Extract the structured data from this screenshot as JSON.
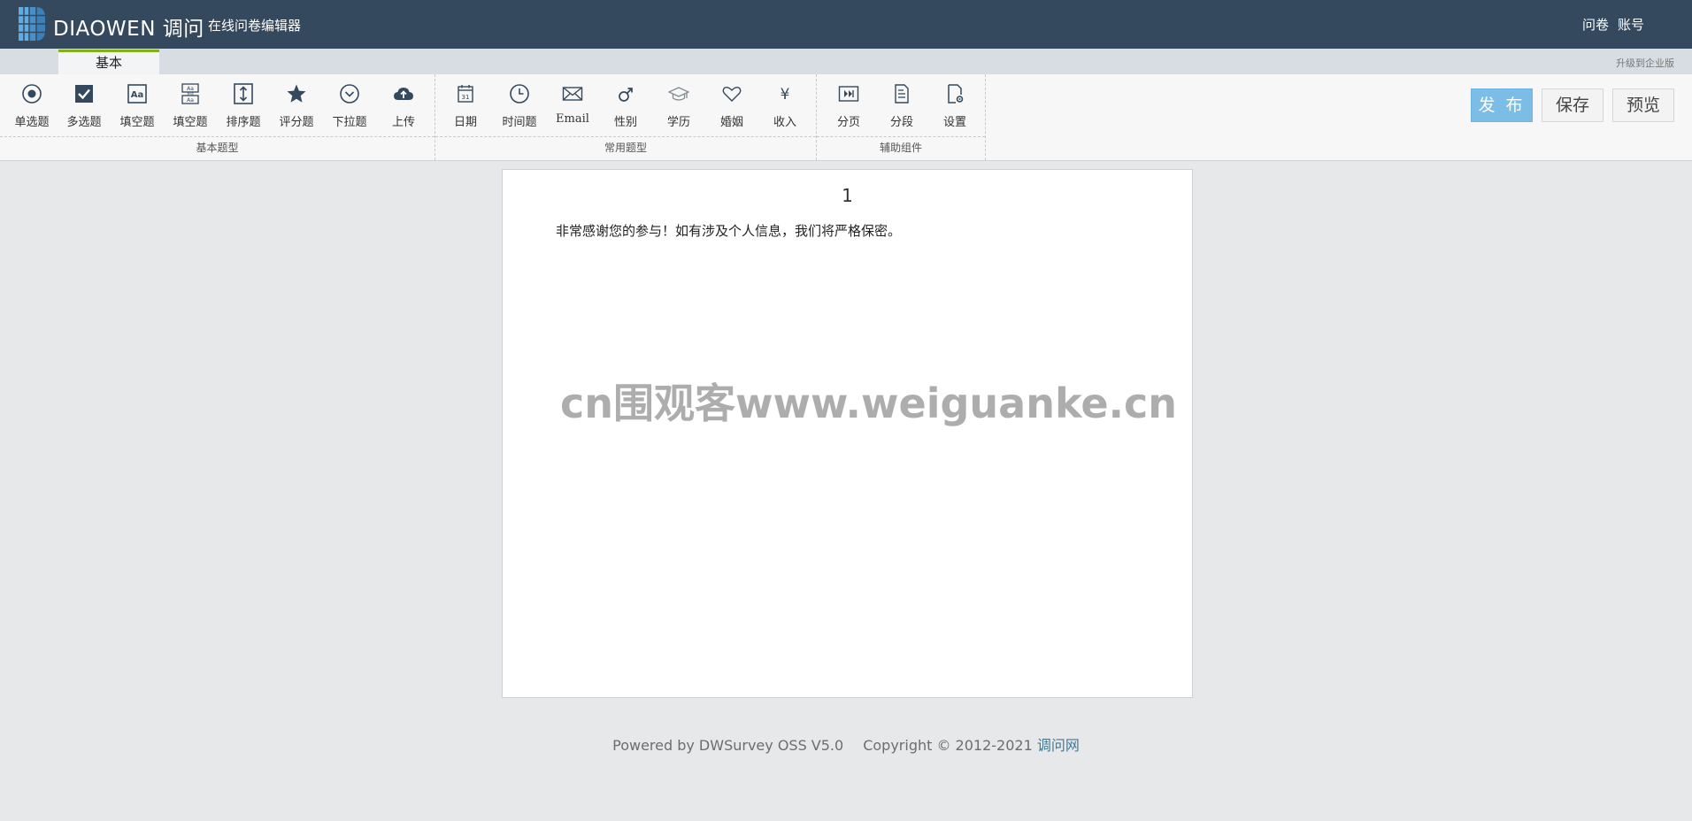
{
  "header": {
    "brand": "DIAOWEN 调问",
    "subtitle": "在线问卷编辑器",
    "nav": [
      "问卷",
      "账号"
    ]
  },
  "tabs": {
    "active": "基本",
    "upgrade_link": "升级到企业版"
  },
  "toolbar": {
    "groups": [
      {
        "label": "基本题型",
        "items": [
          {
            "label": "单选题",
            "icon": "radio-icon"
          },
          {
            "label": "多选题",
            "icon": "checkbox-icon"
          },
          {
            "label": "填空题",
            "icon": "text-fill-icon"
          },
          {
            "label": "填空题",
            "icon": "multi-fill-icon",
            "icon_text": "多项"
          },
          {
            "label": "排序题",
            "icon": "sort-icon"
          },
          {
            "label": "评分题",
            "icon": "star-icon"
          },
          {
            "label": "下拉题",
            "icon": "dropdown-icon"
          },
          {
            "label": "上传",
            "icon": "upload-icon"
          }
        ]
      },
      {
        "label": "常用题型",
        "items": [
          {
            "label": "日期",
            "icon": "calendar-icon",
            "icon_text": "31"
          },
          {
            "label": "时间题",
            "icon": "clock-icon"
          },
          {
            "label": "Email",
            "icon": "email-icon"
          },
          {
            "label": "性别",
            "icon": "gender-icon"
          },
          {
            "label": "学历",
            "icon": "graduation-cap-icon"
          },
          {
            "label": "婚姻",
            "icon": "heart-icon"
          },
          {
            "label": "收入",
            "icon": "yen-icon",
            "icon_text": "¥"
          }
        ]
      },
      {
        "label": "辅助组件",
        "items": [
          {
            "label": "分页",
            "icon": "page-break-icon"
          },
          {
            "label": "分段",
            "icon": "paragraph-icon"
          },
          {
            "label": "设置",
            "icon": "settings-doc-icon"
          }
        ]
      }
    ],
    "actions": {
      "publish": "发 布",
      "save": "保存",
      "preview": "预览"
    }
  },
  "survey": {
    "page_number": "1",
    "intro_text": "非常感谢您的参与！如有涉及个人信息，我们将严格保密。"
  },
  "watermark": "cn围观客www.weiguanke.cn",
  "footer": {
    "powered": "Powered by DWSurvey OSS V5.0",
    "copyright": "Copyright © 2012-2021",
    "link": "调问网"
  },
  "colors": {
    "header_bg": "#34495e",
    "publish_bg": "#7cbde8",
    "tab_accent": "#84b01a",
    "icon": "#34495e"
  }
}
